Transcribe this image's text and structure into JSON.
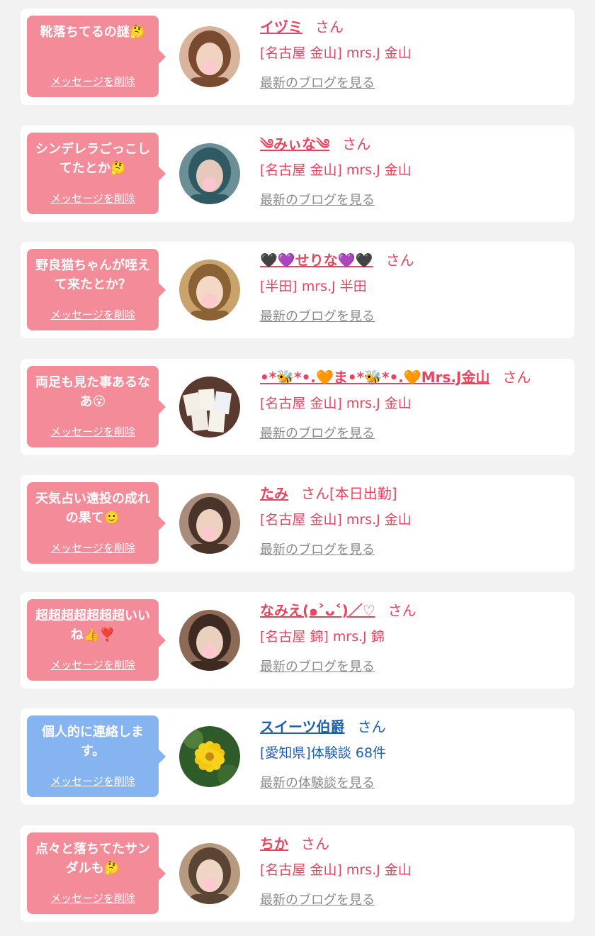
{
  "colors": {
    "pink_bubble": "#f38b98",
    "blue_bubble": "#85b4f0",
    "pink_text": "#e8445f",
    "blue_text": "#1d5fb0",
    "link_gray": "#8a8a8a"
  },
  "items": [
    {
      "theme": "pink",
      "message": "靴落ちてるの謎🤔",
      "delete_label": "メッセージを削除",
      "name": "イヅミ",
      "suffix": "さん",
      "extra": "",
      "shop": "[名古屋 金山] mrs.J 金山",
      "link": "最新のブログを見る",
      "avatar_icon": "woman-avatar-icon"
    },
    {
      "theme": "pink",
      "message": "シンデレラごっこしてたとか🤔",
      "delete_label": "メッセージを削除",
      "name": "༄みぃな༄",
      "suffix": "さん",
      "extra": "",
      "shop": "[名古屋 金山] mrs.J 金山",
      "link": "最新のブログを見る",
      "avatar_icon": "woman-avatar-icon"
    },
    {
      "theme": "pink",
      "message": "野良猫ちゃんが咥えて来たとか？",
      "delete_label": "メッセージを削除",
      "name": "🖤💜せりな💜🖤",
      "suffix": "さん",
      "extra": "",
      "shop": "[半田] mrs.J 半田",
      "link": "最新のブログを見る",
      "avatar_icon": "woman-avatar-icon"
    },
    {
      "theme": "pink",
      "message": "両足も見た事あるなあ😮",
      "delete_label": "メッセージを削除",
      "name": "•*🐝*•.🧡ま•*🐝*•.🧡Mrs.J金山",
      "suffix": "さん",
      "extra": "",
      "shop": "[名古屋 金山] mrs.J 金山",
      "link": "最新のブログを見る",
      "avatar_icon": "cards-avatar-icon"
    },
    {
      "theme": "pink",
      "message": "天気占い遠投の成れの果て🙂",
      "delete_label": "メッセージを削除",
      "name": "たみ",
      "suffix": "さん",
      "extra": "[本日出勤]",
      "shop": "[名古屋 金山] mrs.J 金山",
      "link": "最新のブログを見る",
      "avatar_icon": "woman-avatar-icon"
    },
    {
      "theme": "pink",
      "message": "超超超超超超超いいね👍❣️",
      "delete_label": "メッセージを削除",
      "name": "なみえ(๑˃ᴗ˂)／♡",
      "suffix": "さん",
      "extra": "",
      "shop": "[名古屋 錦] mrs.J 錦",
      "link": "最新のブログを見る",
      "avatar_icon": "woman-avatar-icon"
    },
    {
      "theme": "blue",
      "message": "個人的に連絡します。",
      "delete_label": "メッセージを削除",
      "name": "スイーツ伯爵",
      "suffix": "さん",
      "extra": "",
      "shop": "[愛知県]体験談 68件",
      "link": "最新の体験談を見る",
      "avatar_icon": "flower-avatar-icon"
    },
    {
      "theme": "pink",
      "message": "点々と落ちてたサンダルも🤔",
      "delete_label": "メッセージを削除",
      "name": "ちか",
      "suffix": "さん",
      "extra": "",
      "shop": "[名古屋 金山] mrs.J 金山",
      "link": "最新のブログを見る",
      "avatar_icon": "woman-avatar-icon"
    }
  ]
}
